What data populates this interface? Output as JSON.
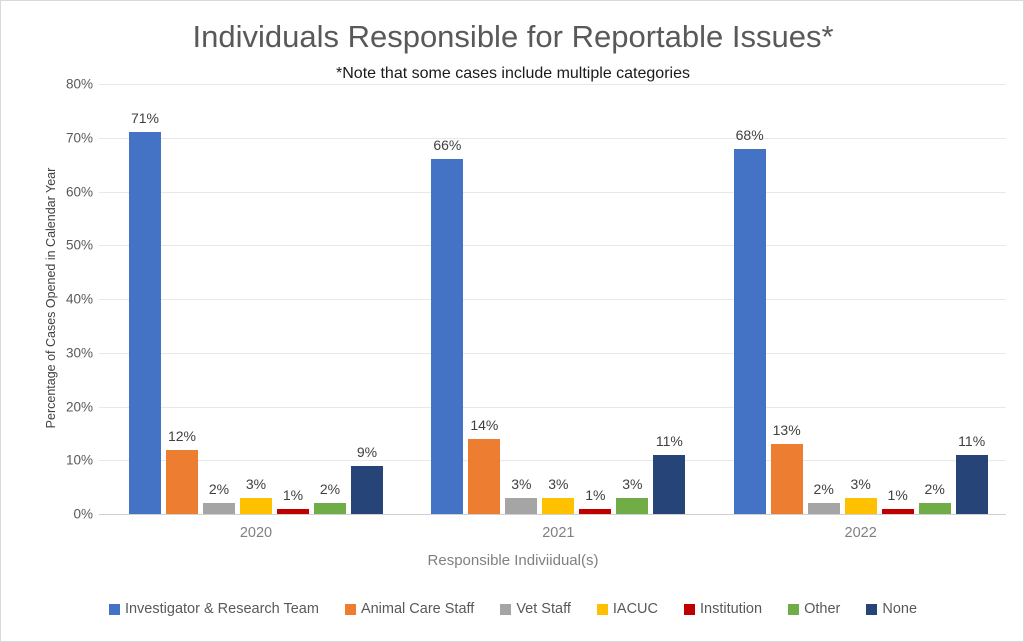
{
  "chart_data": {
    "type": "bar",
    "title": "Individuals Responsible for Reportable Issues*",
    "subtitle": "*Note that some cases include multiple categories",
    "xlabel": "Responsible Indiviidual(s)",
    "ylabel": "Percentage of Cases Opened in Calendar Year",
    "categories": [
      "2020",
      "2021",
      "2022"
    ],
    "ylim": [
      0,
      80
    ],
    "ytick_labels": [
      "0%",
      "10%",
      "20%",
      "30%",
      "40%",
      "50%",
      "60%",
      "70%",
      "80%"
    ],
    "ytick_values": [
      0,
      10,
      20,
      30,
      40,
      50,
      60,
      70,
      80
    ],
    "grid": true,
    "legend_position": "bottom",
    "value_suffix": "%",
    "series": [
      {
        "name": "Investigator & Research Team",
        "color": "#4472C4",
        "values": [
          71,
          66,
          68
        ],
        "labels": [
          "71%",
          "66%",
          "68%"
        ]
      },
      {
        "name": "Animal Care Staff",
        "color": "#ED7D31",
        "values": [
          12,
          14,
          13
        ],
        "labels": [
          "12%",
          "14%",
          "13%"
        ]
      },
      {
        "name": "Vet Staff",
        "color": "#A5A5A5",
        "values": [
          2,
          3,
          2
        ],
        "labels": [
          "2%",
          "3%",
          "2%"
        ]
      },
      {
        "name": "IACUC",
        "color": "#FFC000",
        "values": [
          3,
          3,
          3
        ],
        "labels": [
          "3%",
          "3%",
          "3%"
        ]
      },
      {
        "name": "Institution",
        "color": "#C00000",
        "values": [
          1,
          1,
          1
        ],
        "labels": [
          "1%",
          "1%",
          "1%"
        ]
      },
      {
        "name": "Other",
        "color": "#70AD47",
        "values": [
          2,
          3,
          2
        ],
        "labels": [
          "2%",
          "3%",
          "2%"
        ]
      },
      {
        "name": "None",
        "color": "#264478",
        "values": [
          9,
          11,
          11
        ],
        "labels": [
          "9%",
          "11%",
          "11%"
        ]
      }
    ]
  }
}
